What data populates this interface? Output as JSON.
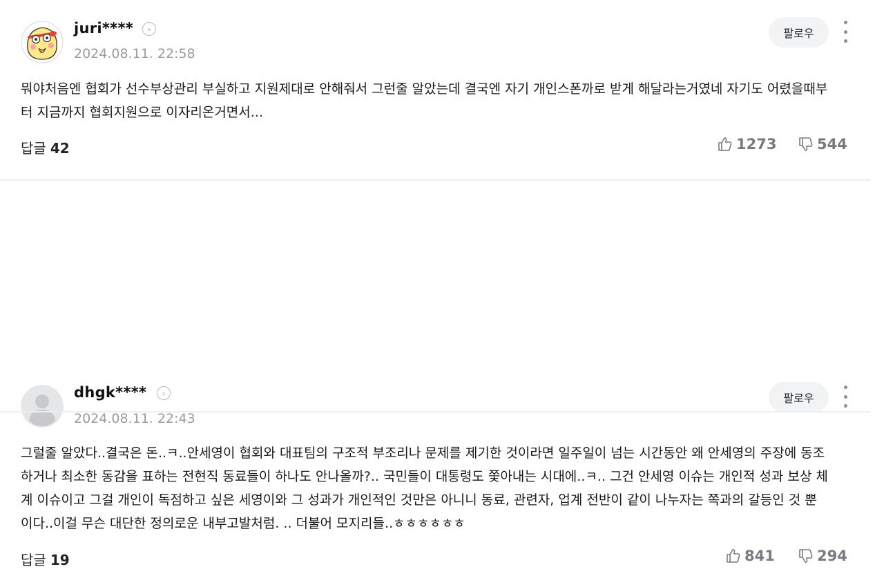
{
  "comments": [
    {
      "username": "juri****",
      "timestamp": "2024.08.11. 22:58",
      "follow_label": "팔로우",
      "text": "뭐야처음엔 협회가 선수부상관리 부실하고 지원제대로 안해줘서 그런줄 알았는데 결국엔 자기 개인스폰까로 받게 해달라는거였네 자기도 어렸을때부터 지금까지 협회지원으로 이자리온거면서...",
      "reply_label": "답글",
      "reply_count": "42",
      "likes": "1273",
      "dislikes": "544",
      "avatar": "character-avatar"
    },
    {
      "username": "dhgk****",
      "timestamp": "2024.08.11. 22:43",
      "follow_label": "팔로우",
      "text": "그럴줄 알았다..결국은 돈..ㅋ..안세영이 협회와 대표팀의 구조적 부조리나 문제를 제기한 것이라면 일주일이 넘는 시간동안 왜 안세영의 주장에 동조하거나 최소한 동감을 표하는 전현직 동료들이 하나도 안나올까?.. 국민들이 대통령도 쫓아내는 시대에..ㅋ.. 그건 안세영 이슈는 개인적 성과 보상 체계 이슈이고 그걸 개인이 독점하고 싶은 세영이와 그 성과가 개인적인 것만은 아니니 동료, 관련자, 업계 전반이 같이 나누자는 쪽과의 갈등인 것 뿐이다..이걸 무슨 대단한 정의로운 내부고발처럼. .. 더불어 모지리들..ㅎㅎㅎㅎㅎㅎ",
      "reply_label": "답글",
      "reply_count": "19",
      "likes": "841",
      "dislikes": "294",
      "avatar": "default-avatar"
    }
  ],
  "icons": {
    "profile_arrow": "chevron-right-icon",
    "more": "more-vertical-icon",
    "like": "thumbs-up-icon",
    "dislike": "thumbs-down-icon"
  },
  "colors": {
    "follow_bg": "#f2f3f5",
    "meta_gray": "#9a9ca1",
    "vote_gray": "#787b80"
  }
}
